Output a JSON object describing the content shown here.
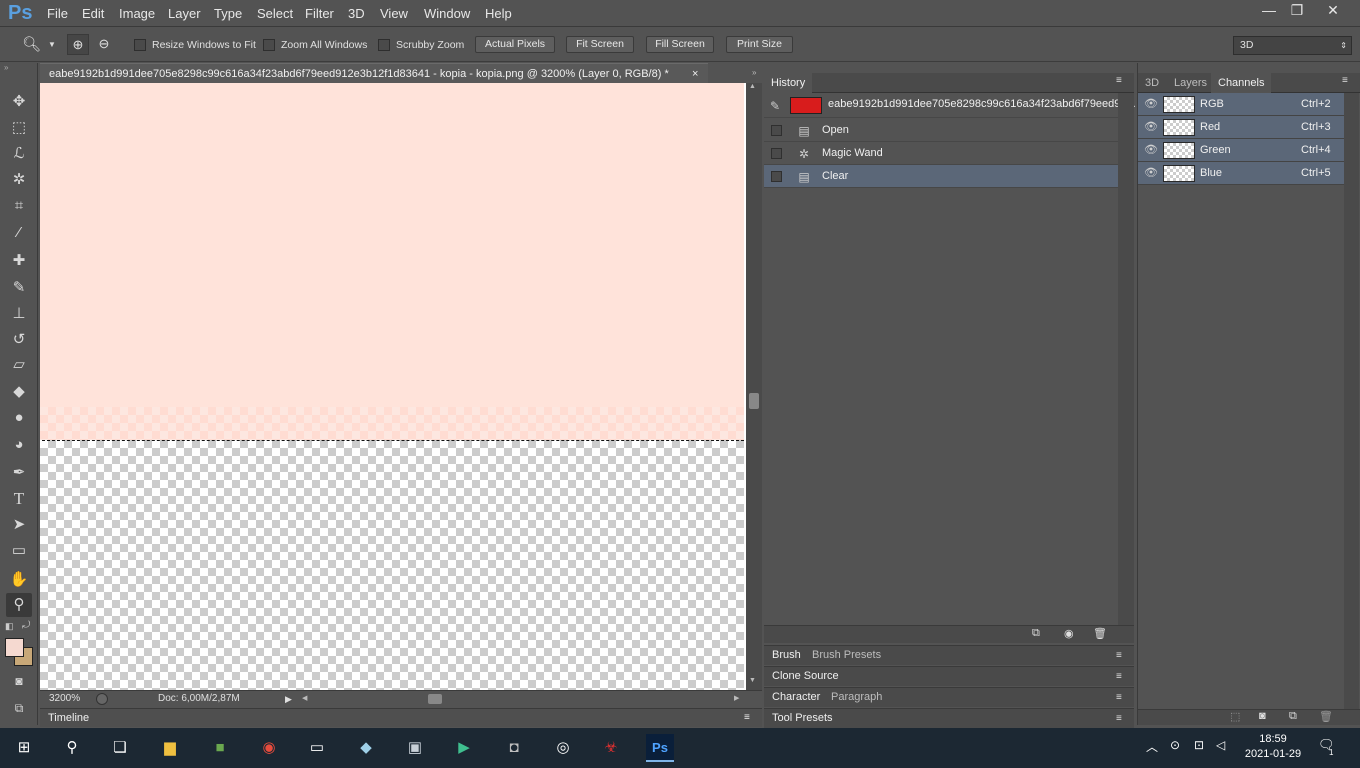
{
  "app": {
    "logo": "Ps"
  },
  "menu": [
    "File",
    "Edit",
    "Image",
    "Layer",
    "Type",
    "Select",
    "Filter",
    "3D",
    "View",
    "Window",
    "Help"
  ],
  "window_controls": {
    "minimize": "—",
    "restore": "❐",
    "close": "✕"
  },
  "options_bar": {
    "resize_windows_label": "Resize Windows to Fit",
    "zoom_all_label": "Zoom All Windows",
    "scrubby_label": "Scrubby Zoom",
    "actual_pixels": "Actual Pixels",
    "fit_screen": "Fit Screen",
    "fill_screen": "Fill Screen",
    "print_size": "Print Size",
    "workspace": "3D"
  },
  "document": {
    "tab_title": "eabe9192b1d991dee705e8298c99c616a34f23abd6f79eed912e3b12f1d83641 - kopia - kopia.png @ 3200% (Layer 0, RGB/8) *",
    "close": "×",
    "zoom": "3200%",
    "doc_info": "Doc: 6,00M/2,87M"
  },
  "timeline_label": "Timeline",
  "history": {
    "tab": "History",
    "snapshot": "eabe9192b1d991dee705e8298c99c616a34f23abd6f79eed91...",
    "items": [
      {
        "label": "Open",
        "icon": "document-icon"
      },
      {
        "label": "Magic Wand",
        "icon": "magic-wand-icon"
      },
      {
        "label": "Clear",
        "icon": "document-icon",
        "selected": true
      }
    ]
  },
  "collapsed_panels": {
    "brush": "Brush",
    "brush_presets": "Brush Presets",
    "clone_source": "Clone Source",
    "character": "Character",
    "paragraph": "Paragraph",
    "tool_presets": "Tool Presets"
  },
  "right_panel": {
    "tabs": [
      "3D",
      "Layers",
      "Channels"
    ],
    "channels": [
      {
        "name": "RGB",
        "shortcut": "Ctrl+2"
      },
      {
        "name": "Red",
        "shortcut": "Ctrl+3"
      },
      {
        "name": "Green",
        "shortcut": "Ctrl+4"
      },
      {
        "name": "Blue",
        "shortcut": "Ctrl+5"
      }
    ]
  },
  "taskbar": {
    "time": "18:59",
    "date": "2021-01-29",
    "notification_count": "1"
  },
  "colors": {
    "foreground": "#f5d9d0",
    "background": "#c8a878",
    "canvas_pink": "#ffe3da",
    "selection": "#5b6778"
  }
}
